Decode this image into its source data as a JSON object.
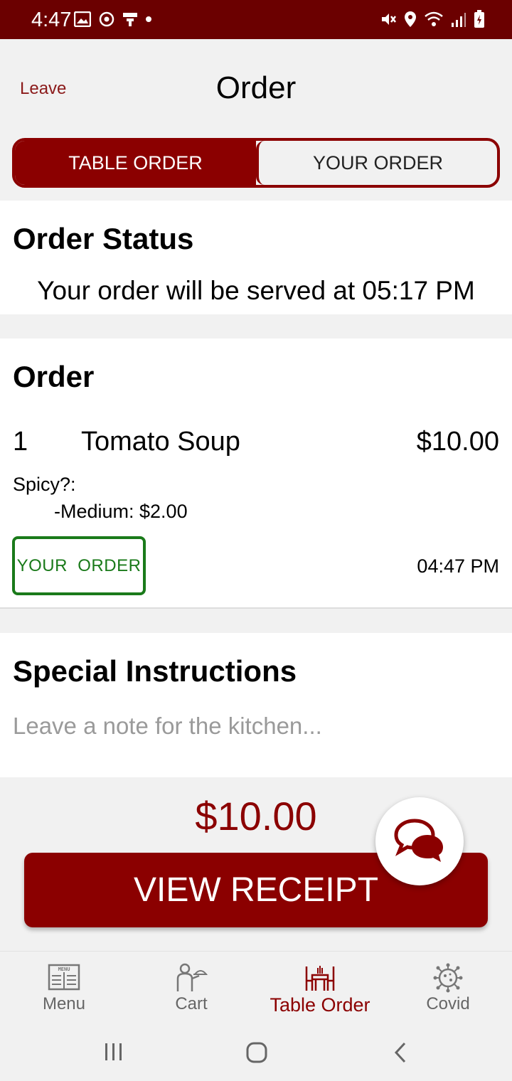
{
  "status_bar": {
    "time": "4:47"
  },
  "header": {
    "leave_label": "Leave",
    "title": "Order",
    "tabs": [
      {
        "label": "TABLE ORDER",
        "active": true
      },
      {
        "label": "YOUR ORDER",
        "active": false
      }
    ]
  },
  "order_status": {
    "heading": "Order Status",
    "message": "Your order will be served at 05:17 PM"
  },
  "order": {
    "heading": "Order",
    "items": [
      {
        "qty": "1",
        "name": "Tomato Soup",
        "price": "$10.00",
        "modifier_label": "Spicy?:",
        "modifier_value": "-Medium: $2.00",
        "badge": "YOUR  ORDER",
        "time": "04:47 PM"
      }
    ]
  },
  "special_instructions": {
    "heading": "Special Instructions",
    "placeholder": "Leave a note for the kitchen..."
  },
  "total": "$10.00",
  "view_receipt_label": "VIEW RECEIPT",
  "bottom_nav": [
    {
      "label": "Menu",
      "icon": "menu-book-icon",
      "active": false
    },
    {
      "label": "Cart",
      "icon": "waiter-icon",
      "active": false
    },
    {
      "label": "Table Order",
      "icon": "table-icon",
      "active": true
    },
    {
      "label": "Covid",
      "icon": "virus-icon",
      "active": false
    }
  ],
  "colors": {
    "brand": "#8b0000",
    "status_bar": "#6b0000",
    "badge_green": "#1a7a1a"
  }
}
